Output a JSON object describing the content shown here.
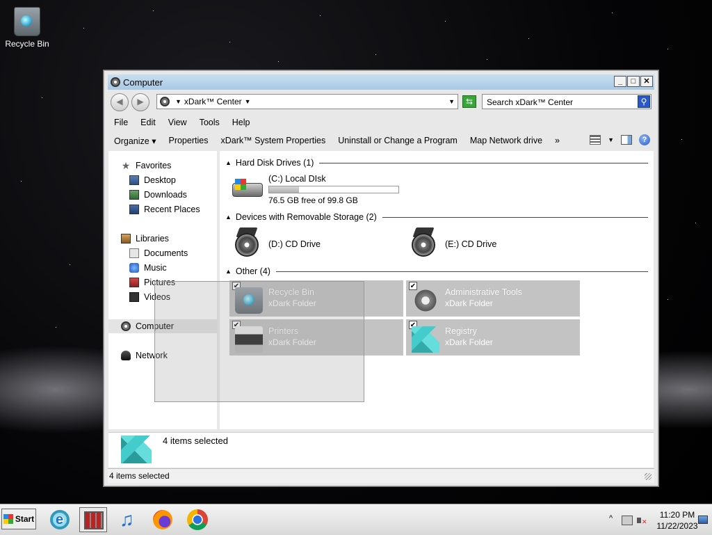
{
  "desktop": {
    "icons": [
      {
        "label": "Recycle Bin",
        "icon": "recycle-bin-icon"
      }
    ]
  },
  "window": {
    "title": "Computer",
    "buttons": {
      "minimize": "_",
      "maximize": "□",
      "close": "✕"
    },
    "address": {
      "location": "xDark™ Center"
    },
    "search": {
      "placeholder": "Search xDark™ Center"
    },
    "menu": [
      "File",
      "Edit",
      "View",
      "Tools",
      "Help"
    ],
    "toolbar": {
      "organize": "Organize",
      "properties": "Properties",
      "system_properties": "xDark™ System Properties",
      "uninstall": "Uninstall or Change a Program",
      "map_drive": "Map Network drive",
      "more": "»"
    },
    "nav": {
      "favorites": {
        "label": "Favorites",
        "items": [
          "Desktop",
          "Downloads",
          "Recent Places"
        ]
      },
      "libraries": {
        "label": "Libraries",
        "items": [
          "Documents",
          "Music",
          "Pictures",
          "Videos"
        ]
      },
      "computer": "Computer",
      "network": "Network"
    },
    "groups": {
      "hdd": {
        "label": "Hard Disk Drives (1)"
      },
      "removable": {
        "label": "Devices with Removable Storage (2)"
      },
      "other": {
        "label": "Other (4)"
      }
    },
    "drives": {
      "c": {
        "name": "(C:) Local DIsk",
        "free_text": "76.5 GB free of 99.8 GB",
        "used_fraction": 0.233
      },
      "d": {
        "name": "(D:) CD Drive"
      },
      "e": {
        "name": "(E:) CD Drive"
      }
    },
    "other_items": [
      {
        "name": "Recycle Bin",
        "type": "xDark Folder",
        "checked": true,
        "icon": "recycle-bin-icon"
      },
      {
        "name": "Administrative Tools",
        "type": "xDark Folder",
        "checked": true,
        "icon": "admin-tools-icon"
      },
      {
        "name": "Printers",
        "type": "xDark Folder",
        "checked": true,
        "icon": "printer-icon"
      },
      {
        "name": "Registry",
        "type": "xDark Folder",
        "checked": true,
        "icon": "registry-icon"
      }
    ],
    "details": {
      "text": "4 items selected"
    },
    "status": {
      "text": "4 items selected"
    }
  },
  "taskbar": {
    "start": "Start",
    "apps": [
      "internet-explorer",
      "file-explorer",
      "music-player",
      "firefox",
      "chrome"
    ],
    "time": "11:20 PM",
    "date": "11/22/2023"
  }
}
